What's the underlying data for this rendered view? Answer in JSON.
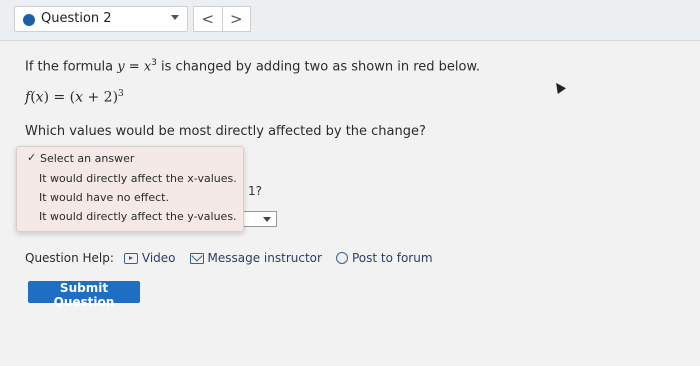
{
  "header": {
    "question_label": "Question 2",
    "prev_glyph": "<",
    "next_glyph": ">"
  },
  "question": {
    "intro_before": "If the formula ",
    "formula_y": "y",
    "formula_eq": " = ",
    "formula_x": "x",
    "formula_exp": "3",
    "intro_after": " is changed by adding two as shown in red below.",
    "f_name": "f",
    "f_var": "x",
    "f_mid": " = (",
    "f_x": "x",
    "f_plus": " + 2)",
    "f_exp": "3",
    "prompt": "Which values would be most directly affected by the change?",
    "obscured_fragment": "1?"
  },
  "dropdown": {
    "checkmark": "✓",
    "options": [
      "Select an answer",
      "It would directly affect the x-values.",
      "It would have no effect.",
      "It would directly affect the y-values."
    ]
  },
  "help": {
    "label": "Question Help:",
    "video": "Video",
    "message": "Message instructor",
    "forum": "Post to forum",
    "icons": [
      "video-icon",
      "mail-icon",
      "forum-icon"
    ]
  },
  "submit_label": "Submit Question",
  "colors": {
    "accent": "#1e6fc4",
    "status_dot": "#1d5fa6",
    "dropdown_bg": "#f4e9e7"
  }
}
